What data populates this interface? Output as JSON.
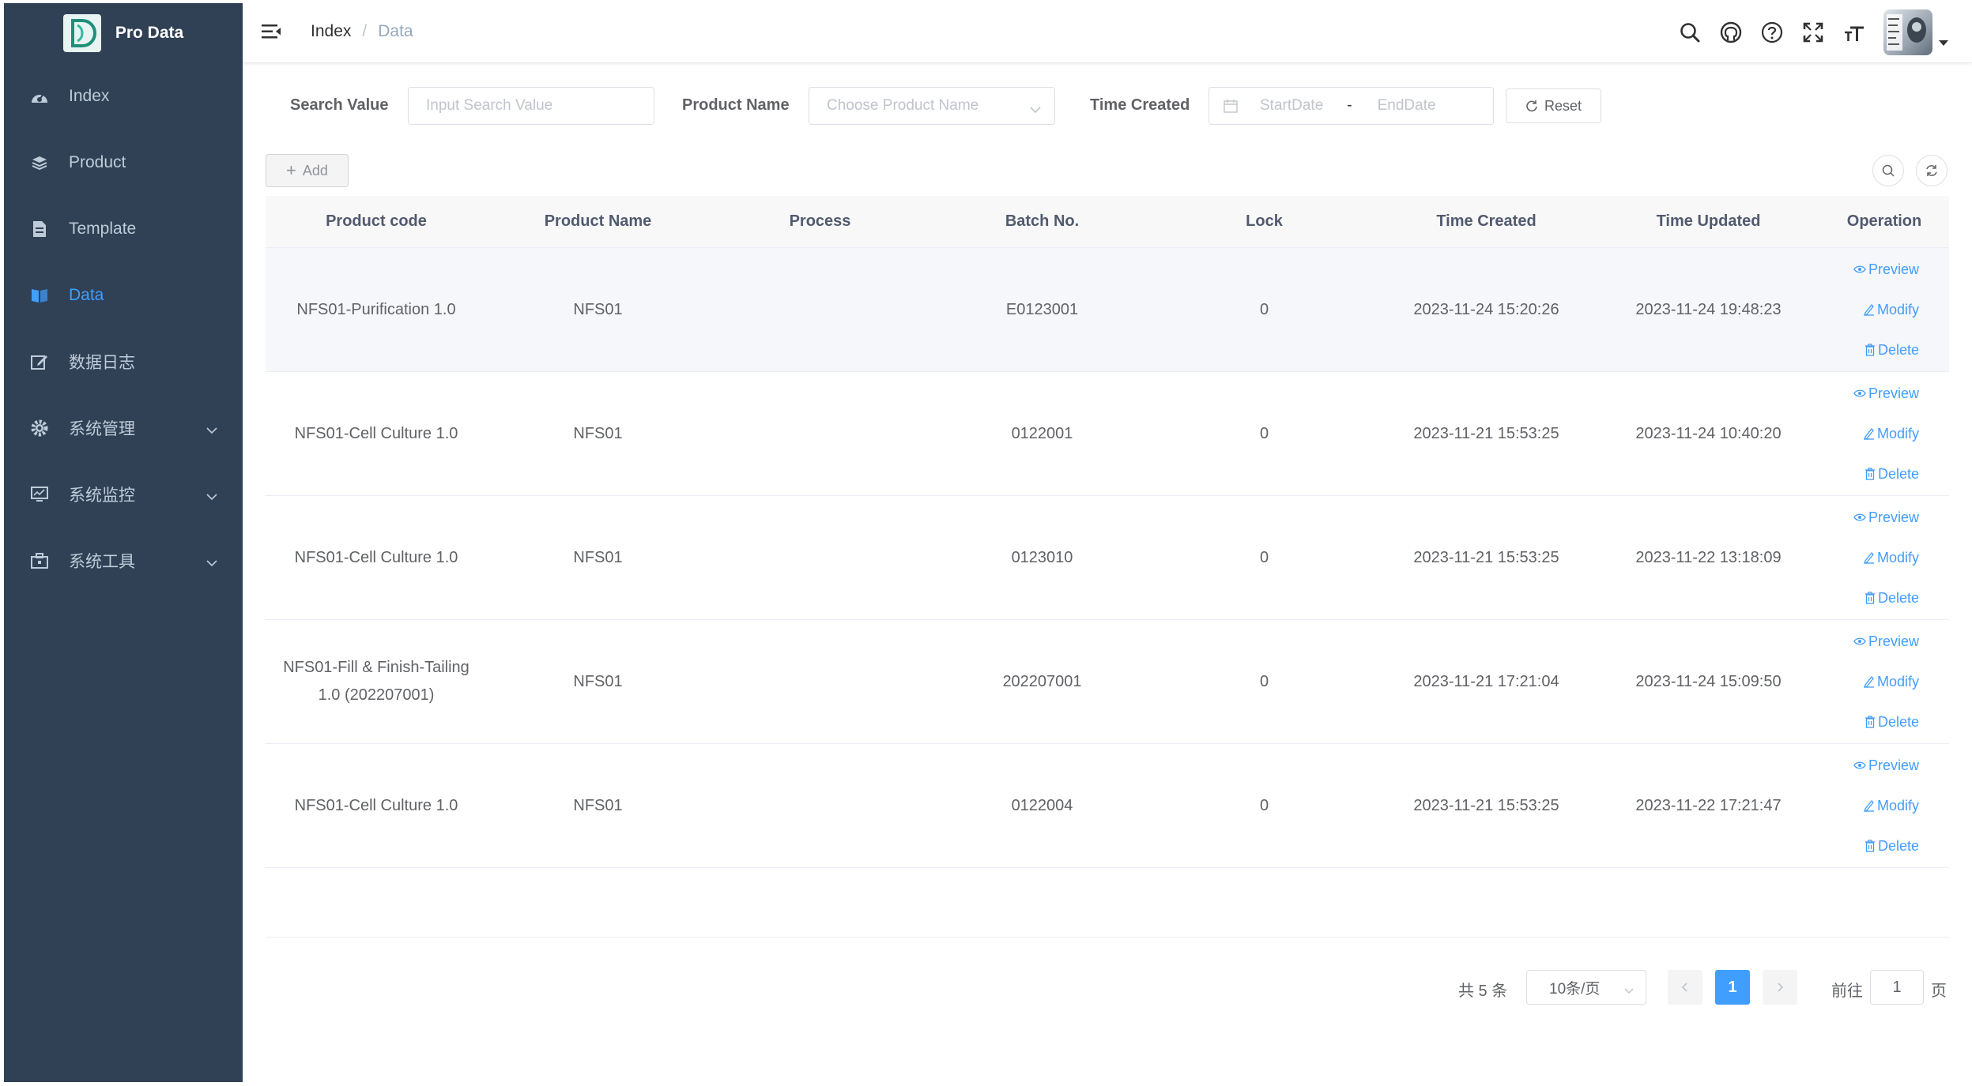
{
  "app": {
    "title": "Pro Data"
  },
  "sidebar": {
    "items": [
      {
        "label": "Index",
        "icon": "dashboard-icon"
      },
      {
        "label": "Product",
        "icon": "layers-icon"
      },
      {
        "label": "Template",
        "icon": "document-icon"
      },
      {
        "label": "Data",
        "icon": "book-icon",
        "active": true
      },
      {
        "label": "数据日志",
        "icon": "edit-icon"
      },
      {
        "label": "系统管理",
        "icon": "gear-icon",
        "expandable": true
      },
      {
        "label": "系统监控",
        "icon": "monitor-icon",
        "expandable": true
      },
      {
        "label": "系统工具",
        "icon": "toolbox-icon",
        "expandable": true
      }
    ]
  },
  "breadcrumb": {
    "root": "Index",
    "separator": "/",
    "current": "Data"
  },
  "search": {
    "value_label": "Search Value",
    "value_placeholder": "Input Search Value",
    "product_label": "Product Name",
    "product_placeholder": "Choose Product Name",
    "time_label": "Time Created",
    "start_placeholder": "StartDate",
    "range_separator": "-",
    "end_placeholder": "EndDate",
    "reset_label": "Reset"
  },
  "toolbar": {
    "add_label": "Add"
  },
  "table": {
    "headers": [
      "Product code",
      "Product Name",
      "Process",
      "Batch No.",
      "Lock",
      "Time Created",
      "Time Updated",
      "Operation"
    ],
    "rows": [
      {
        "code": "NFS01-Purification 1.0",
        "name": "NFS01",
        "process": "",
        "batch": "E0123001",
        "lock": "0",
        "created": "2023-11-24 15:20:26",
        "updated": "2023-11-24 19:48:23"
      },
      {
        "code": "NFS01-Cell Culture 1.0",
        "name": "NFS01",
        "process": "",
        "batch": "0122001",
        "lock": "0",
        "created": "2023-11-21 15:53:25",
        "updated": "2023-11-24 10:40:20"
      },
      {
        "code": "NFS01-Cell Culture 1.0",
        "name": "NFS01",
        "process": "",
        "batch": "0123010",
        "lock": "0",
        "created": "2023-11-21 15:53:25",
        "updated": "2023-11-22 13:18:09"
      },
      {
        "code": "NFS01-Fill & Finish-Tailing 1.0 (202207001)",
        "name": "NFS01",
        "process": "",
        "batch": "202207001",
        "lock": "0",
        "created": "2023-11-21 17:21:04",
        "updated": "2023-11-24 15:09:50"
      },
      {
        "code": "NFS01-Cell Culture 1.0",
        "name": "NFS01",
        "process": "",
        "batch": "0122004",
        "lock": "0",
        "created": "2023-11-21 15:53:25",
        "updated": "2023-11-22 17:21:47"
      }
    ],
    "operations": {
      "preview": "Preview",
      "modify": "Modify",
      "delete": "Delete"
    }
  },
  "pagination": {
    "total": "共 5 条",
    "page_size": "10条/页",
    "current_page": "1",
    "goto_label": "前往",
    "goto_value": "1",
    "page_suffix": "页"
  },
  "colors": {
    "sidebar_bg": "#304156",
    "sidebar_text": "#bfcbd9",
    "accent": "#409eff"
  }
}
